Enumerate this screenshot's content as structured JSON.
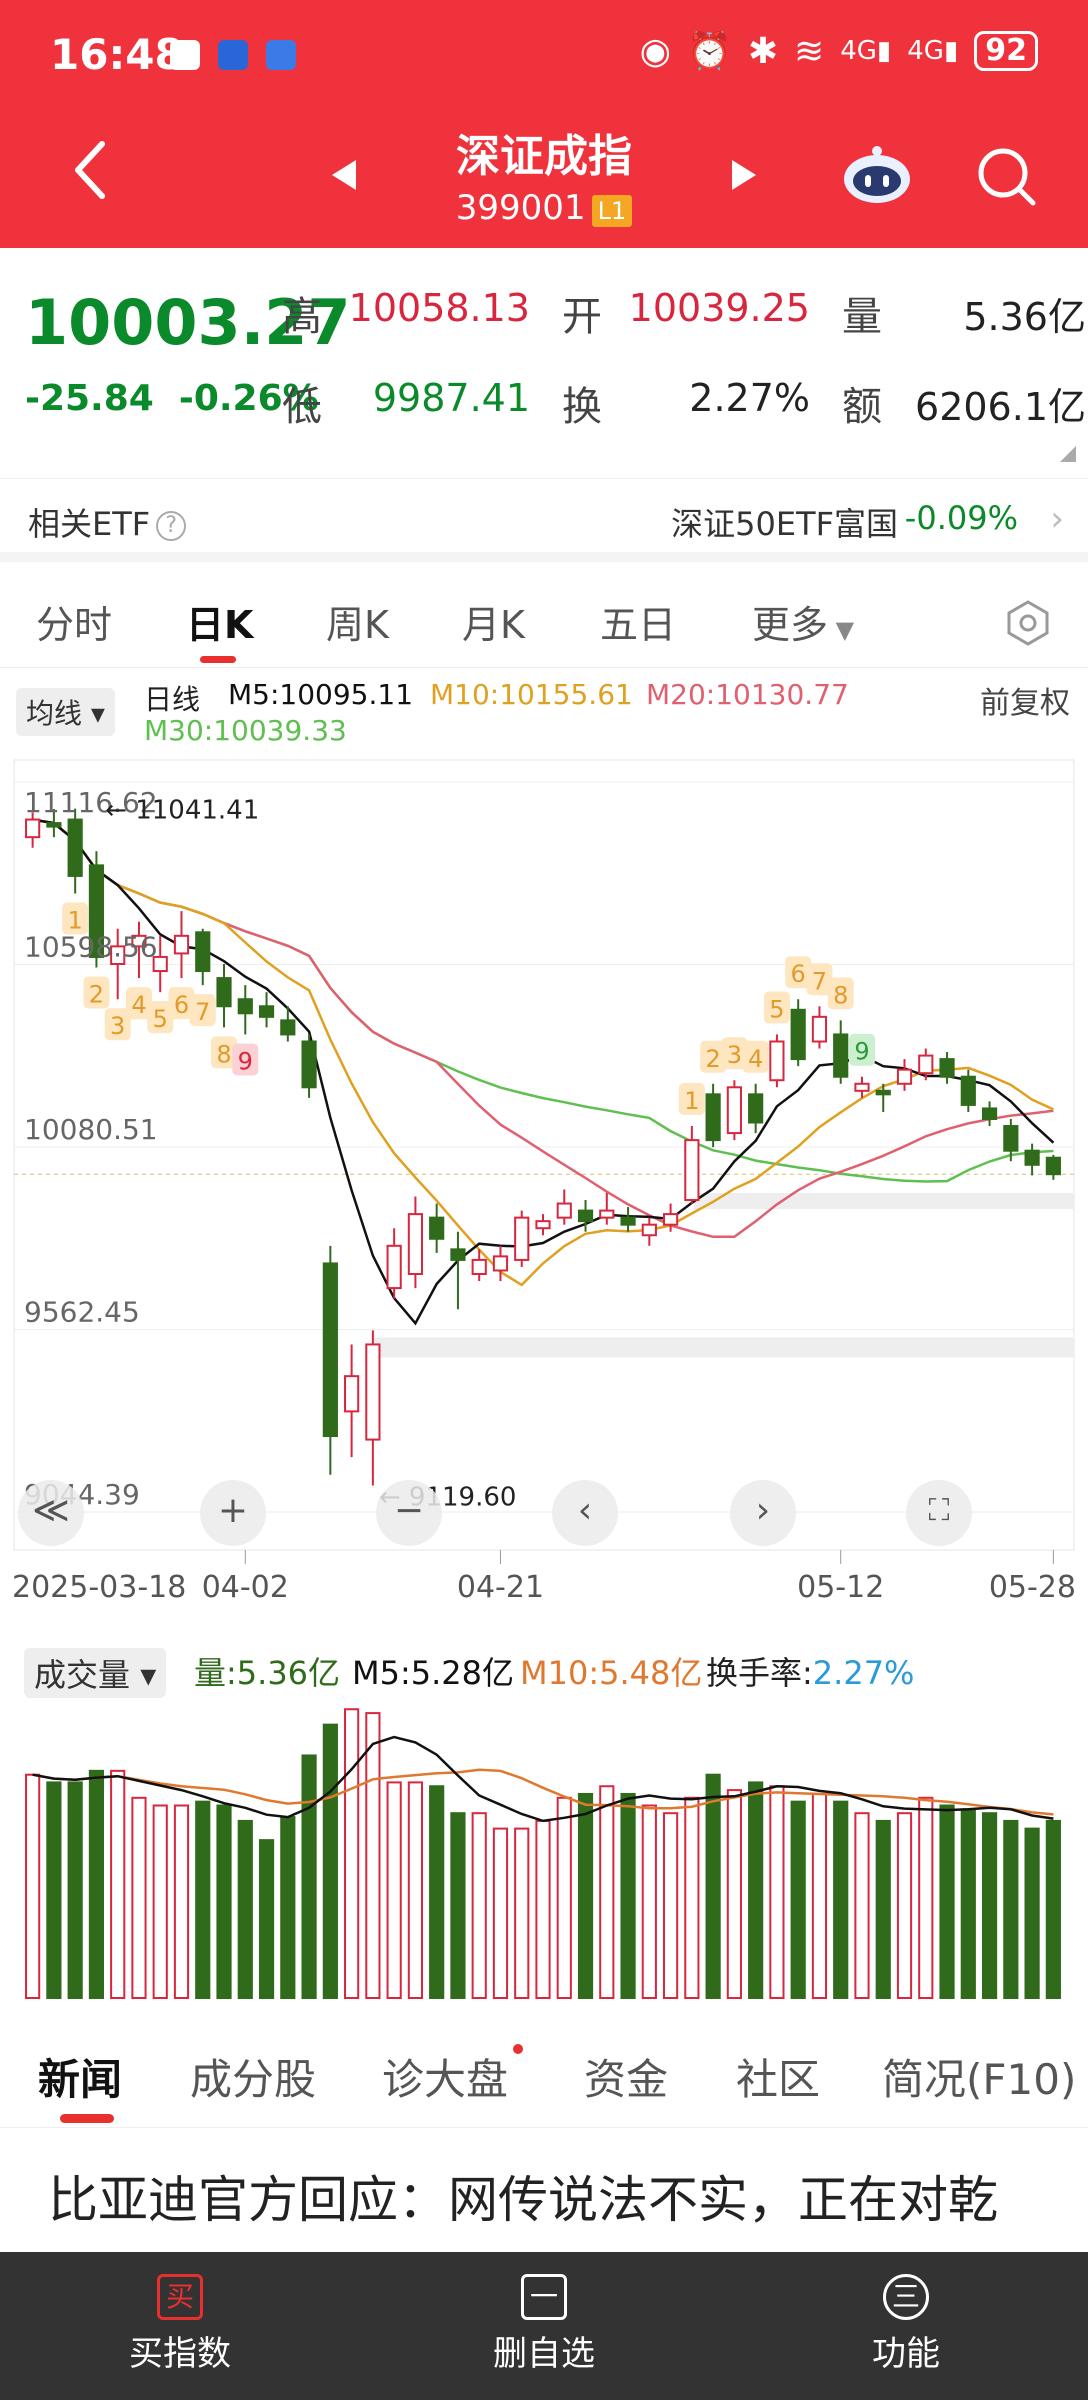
{
  "status_bar": {
    "time": "16:48",
    "battery": "92",
    "network": "4G"
  },
  "header": {
    "title": "深证成指",
    "code": "399001",
    "level": "L1"
  },
  "quote": {
    "last": "10003.27",
    "change": "-25.84",
    "change_pct": "-0.26%",
    "high_label": "高",
    "high": "10058.13",
    "open_label": "开",
    "open": "10039.25",
    "vol_label": "量",
    "volume": "5.36亿",
    "low_label": "低",
    "low": "9987.41",
    "turn_label": "换",
    "turnover_rate": "2.27%",
    "amt_label": "额",
    "amount": "6206.1亿"
  },
  "etf": {
    "label": "相关ETF",
    "help": "?",
    "name": "深证50ETF富国",
    "change": "-0.09%"
  },
  "period_tabs": [
    "分时",
    "日K",
    "周K",
    "月K",
    "五日",
    "更多"
  ],
  "active_period": "日K",
  "legend": {
    "ma_select": "均线",
    "period": "日线",
    "m5": "M5:10095.11",
    "m10": "M10:10155.61",
    "m20": "M20:10130.77",
    "m30": "M30:10039.33",
    "adjust": "前复权"
  },
  "colors": {
    "up": "#d7263d",
    "down": "#2f6b1b",
    "m5": "#111111",
    "m10": "#e0a020",
    "m20": "#e06070",
    "m30": "#5fbf50",
    "brand": "#f0323c"
  },
  "chart_data": [
    {
      "type": "candlestick",
      "y_ticks": [
        "11116.62",
        "10598.56",
        "10080.51",
        "9562.45",
        "9044.39"
      ],
      "ylim": [
        9044.39,
        11116.62
      ],
      "x_ticks": [
        "2025-03-18",
        "04-02",
        "04-21",
        "05-12",
        "05-28"
      ],
      "annotations": {
        "high_marker": "11041.41",
        "low_marker": "9119.60"
      },
      "candles": [
        [
          10960,
          11010,
          10930,
          11030
        ],
        [
          11000,
          10990,
          10960,
          11040
        ],
        [
          11010,
          10850,
          10800,
          11041
        ],
        [
          10880,
          10620,
          10590,
          10920
        ],
        [
          10600,
          10650,
          10500,
          10700
        ],
        [
          10650,
          10680,
          10560,
          10720
        ],
        [
          10580,
          10620,
          10520,
          10680
        ],
        [
          10630,
          10680,
          10560,
          10750
        ],
        [
          10690,
          10580,
          10540,
          10700
        ],
        [
          10560,
          10480,
          10420,
          10600
        ],
        [
          10500,
          10460,
          10400,
          10540
        ],
        [
          10480,
          10450,
          10420,
          10520
        ],
        [
          10440,
          10400,
          10380,
          10480
        ],
        [
          10380,
          10250,
          10220,
          10400
        ],
        [
          9750,
          9260,
          9150,
          9800
        ],
        [
          9330,
          9430,
          9200,
          9520
        ],
        [
          9250,
          9520,
          9119.6,
          9560
        ],
        [
          9680,
          9800,
          9650,
          9850
        ],
        [
          9720,
          9890,
          9680,
          9940
        ],
        [
          9880,
          9820,
          9780,
          9920
        ],
        [
          9790,
          9760,
          9620,
          9840
        ],
        [
          9720,
          9760,
          9700,
          9790
        ],
        [
          9730,
          9770,
          9700,
          9800
        ],
        [
          9760,
          9880,
          9740,
          9900
        ],
        [
          9850,
          9870,
          9830,
          9890
        ],
        [
          9880,
          9920,
          9860,
          9960
        ],
        [
          9900,
          9870,
          9840,
          9930
        ],
        [
          9880,
          9900,
          9860,
          9950
        ],
        [
          9880,
          9860,
          9840,
          9910
        ],
        [
          9830,
          9860,
          9800,
          9880
        ],
        [
          9860,
          9890,
          9840,
          9920
        ],
        [
          9930,
          10100,
          9920,
          10140
        ],
        [
          10230,
          10100,
          10080,
          10260
        ],
        [
          10120,
          10250,
          10100,
          10270
        ],
        [
          10230,
          10150,
          10120,
          10260
        ],
        [
          10270,
          10380,
          10250,
          10400
        ],
        [
          10470,
          10330,
          10310,
          10500
        ],
        [
          10380,
          10450,
          10360,
          10480
        ],
        [
          10400,
          10280,
          10260,
          10440
        ],
        [
          10240,
          10260,
          10220,
          10280
        ],
        [
          10240,
          10230,
          10180,
          10260
        ],
        [
          10260,
          10300,
          10240,
          10330
        ],
        [
          10290,
          10340,
          10270,
          10360
        ],
        [
          10330,
          10280,
          10260,
          10350
        ],
        [
          10280,
          10200,
          10180,
          10300
        ],
        [
          10190,
          10160,
          10140,
          10210
        ],
        [
          10140,
          10070,
          10040,
          10160
        ],
        [
          10070,
          10030,
          10000,
          10090
        ],
        [
          10050,
          10003.27,
          9987.41,
          10058.13
        ]
      ],
      "markers": [
        {
          "candle": 2,
          "label": "1",
          "color": "orange"
        },
        {
          "candle": 3,
          "label": "2",
          "color": "orange"
        },
        {
          "candle": 4,
          "label": "3",
          "color": "orange"
        },
        {
          "candle": 5,
          "label": "4",
          "color": "orange"
        },
        {
          "candle": 6,
          "label": "5",
          "color": "orange"
        },
        {
          "candle": 7,
          "label": "6",
          "color": "orange"
        },
        {
          "candle": 8,
          "label": "7",
          "color": "orange"
        },
        {
          "candle": 9,
          "label": "8",
          "color": "orange"
        },
        {
          "candle": 10,
          "label": "9",
          "color": "red"
        },
        {
          "candle": 31,
          "label": "1",
          "color": "orange"
        },
        {
          "candle": 32,
          "label": "2",
          "color": "orange"
        },
        {
          "candle": 33,
          "label": "3",
          "color": "orange"
        },
        {
          "candle": 34,
          "label": "4",
          "color": "orange"
        },
        {
          "candle": 35,
          "label": "5",
          "color": "orange"
        },
        {
          "candle": 36,
          "label": "6",
          "color": "orange"
        },
        {
          "candle": 37,
          "label": "7",
          "color": "orange"
        },
        {
          "candle": 38,
          "label": "8",
          "color": "orange"
        },
        {
          "candle": 39,
          "label": "9",
          "color": "green"
        }
      ]
    },
    {
      "type": "bar",
      "title": "成交量",
      "legend": {
        "vol": "量:5.36亿",
        "m5": "M5:5.28亿",
        "m10": "M10:5.48亿",
        "turnover": "换手率:",
        "turnover_val": "2.27%"
      },
      "values": [
        5.8,
        5.6,
        5.6,
        5.9,
        5.9,
        5.2,
        5.0,
        5.0,
        5.1,
        5.0,
        4.6,
        4.1,
        4.7,
        6.3,
        7.1,
        7.5,
        7.4,
        5.6,
        5.6,
        5.5,
        4.8,
        4.8,
        4.4,
        4.4,
        4.6,
        5.2,
        5.3,
        5.5,
        5.3,
        5.0,
        4.8,
        5.2,
        5.8,
        5.4,
        5.6,
        5.5,
        5.1,
        5.3,
        5.1,
        4.8,
        4.6,
        4.8,
        5.2,
        5.0,
        4.9,
        4.8,
        4.6,
        4.4,
        4.6
      ]
    }
  ],
  "nav_controls": {
    "rewind": "≪",
    "zoom_in": "+",
    "zoom_out": "−",
    "prev": "‹",
    "next": "›"
  },
  "news_tabs": [
    "新闻",
    "成分股",
    "诊大盘",
    "资金",
    "社区",
    "简况(F10)"
  ],
  "news": {
    "headline": "比亚迪官方回应：网传说法不实，正在对乾"
  },
  "bottom_bar": [
    {
      "icon": "买",
      "label": "买指数"
    },
    {
      "icon": "一",
      "label": "删自选"
    },
    {
      "icon": "三",
      "label": "功能"
    }
  ]
}
